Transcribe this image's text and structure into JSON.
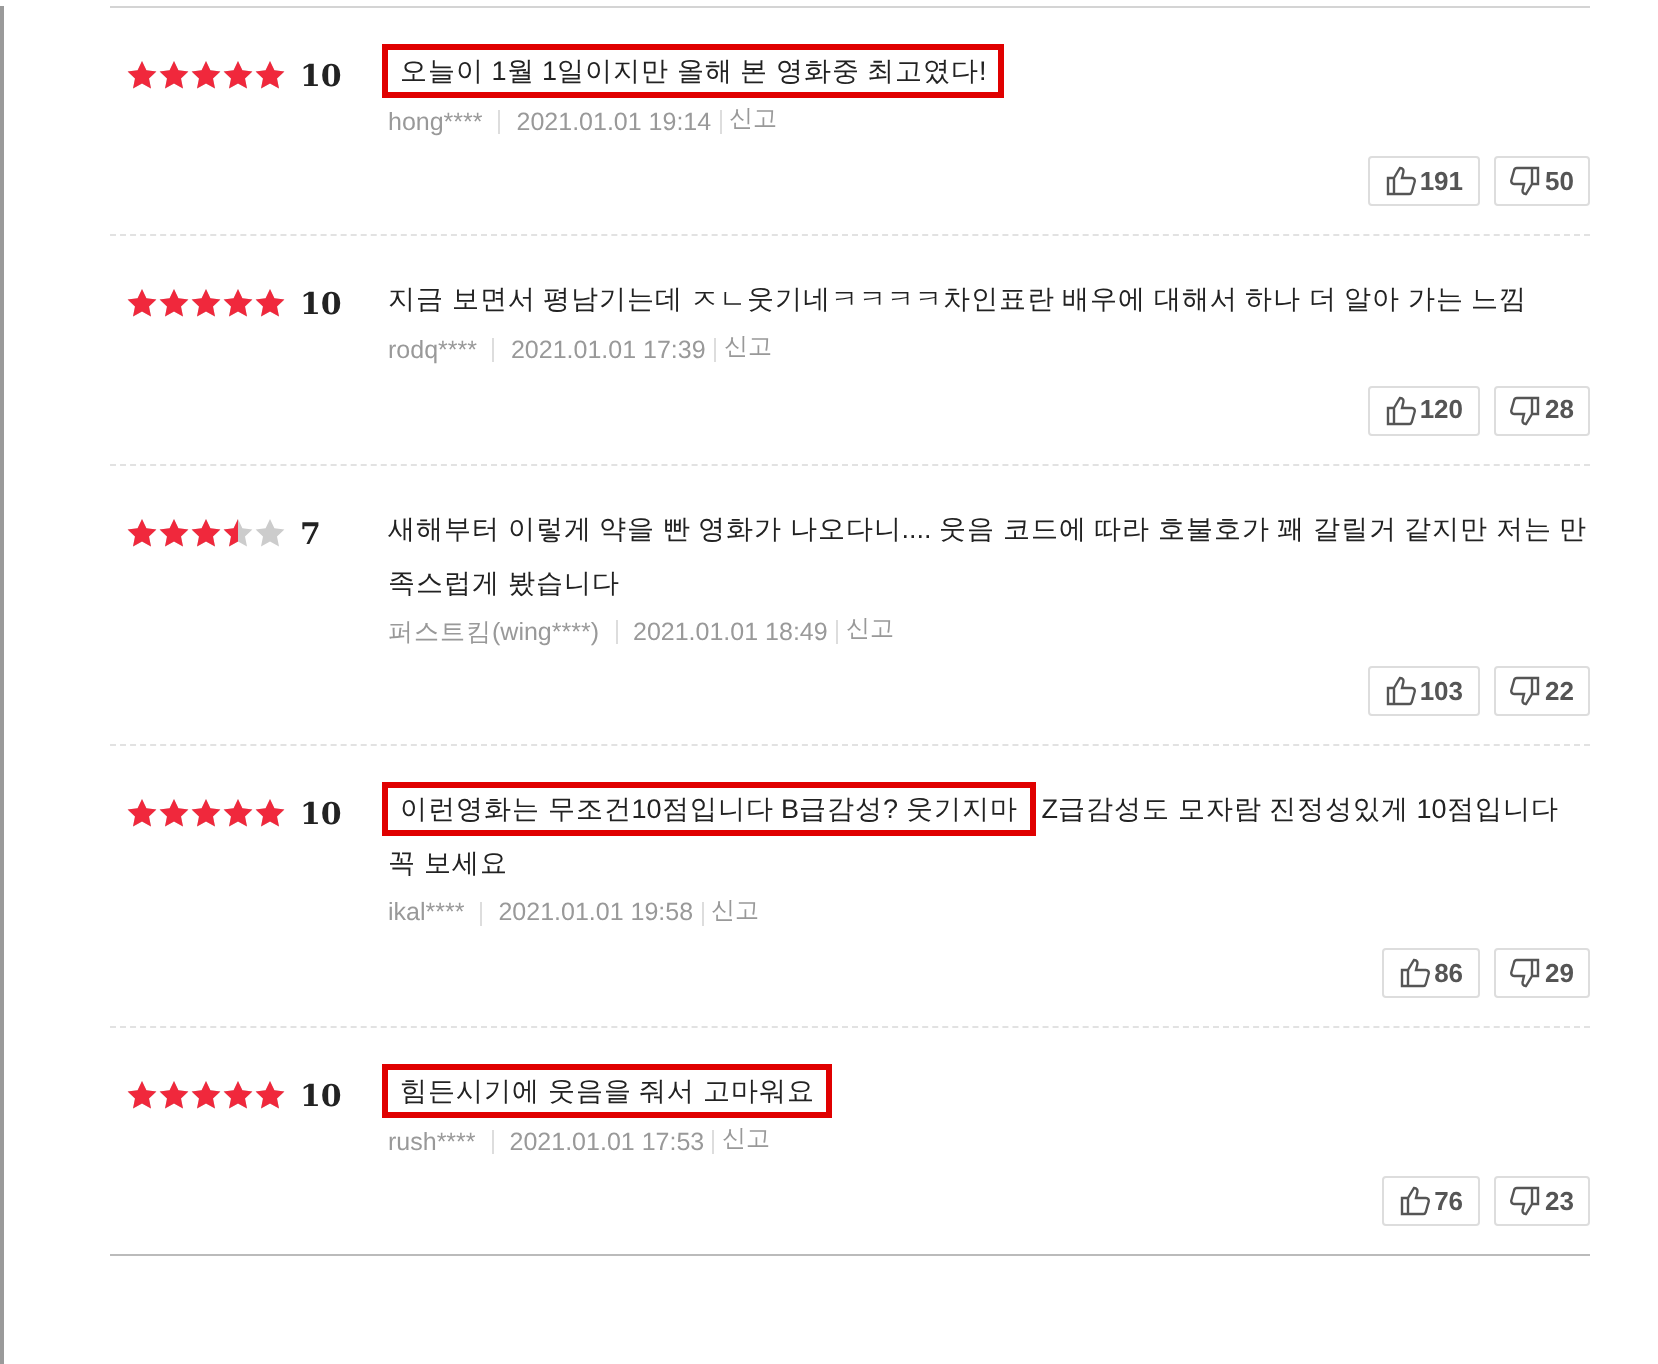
{
  "reviews": [
    {
      "stars": 5,
      "score": "10",
      "segments": [
        {
          "text": "오늘이 1월 1일이지만 올해 본 영화중 최고였다!",
          "highlighted": true
        }
      ],
      "author": "hong****",
      "date": "2021.01.01 19:14",
      "report": "신고",
      "likes": "191",
      "dislikes": "50"
    },
    {
      "stars": 5,
      "score": "10",
      "segments": [
        {
          "text": "지금 보면서 평남기는데 ㅈㄴ웃기네ㅋㅋㅋㅋ차인표란 배우에 대해서 하나 더 알아 가는 느낌",
          "highlighted": false
        }
      ],
      "author": "rodq****",
      "date": "2021.01.01 17:39",
      "report": "신고",
      "likes": "120",
      "dislikes": "28"
    },
    {
      "stars": 3.5,
      "score": "7",
      "segments": [
        {
          "text": "새해부터 이렇게 약을 빤 영화가 나오다니.... 웃음 코드에 따라 호불호가 꽤 갈릴거 같지만 저는 만족스럽게 봤습니다",
          "highlighted": false
        }
      ],
      "author": "퍼스트킴(wing****)",
      "date": "2021.01.01 18:49",
      "report": "신고",
      "likes": "103",
      "dislikes": "22"
    },
    {
      "stars": 5,
      "score": "10",
      "segments": [
        {
          "text": "이런영화는 무조건10점입니다 B급감성? 웃기지마",
          "highlighted": true
        },
        {
          "text": "Z급감성도 모자람 진정성있게  10점입니다 꼭 보세요",
          "highlighted": false
        }
      ],
      "author": "ikal****",
      "date": "2021.01.01 19:58",
      "report": "신고",
      "likes": "86",
      "dislikes": "29"
    },
    {
      "stars": 5,
      "score": "10",
      "segments": [
        {
          "text": "힘든시기에 웃음을 줘서 고마워요",
          "highlighted": true
        }
      ],
      "author": "rush****",
      "date": "2021.01.01 17:53",
      "report": "신고",
      "likes": "76",
      "dislikes": "23"
    }
  ]
}
